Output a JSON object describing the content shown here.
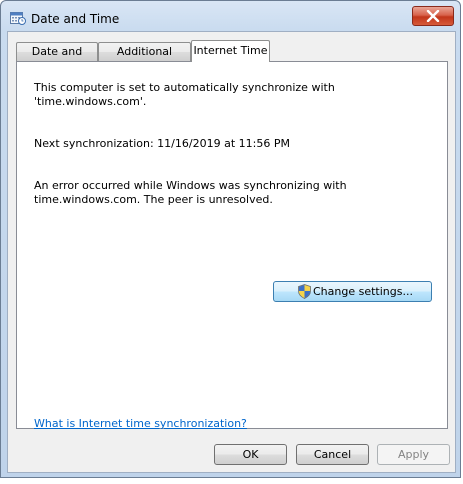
{
  "window": {
    "title": "Date and Time"
  },
  "tabs": [
    {
      "label": "Date and Time",
      "active": false
    },
    {
      "label": "Additional Clocks",
      "active": false
    },
    {
      "label": "Internet Time",
      "active": true
    }
  ],
  "internet_time": {
    "sync_line1": "This computer is set to automatically synchronize with",
    "sync_line2": "'time.windows.com'.",
    "next_sync": "Next synchronization: 11/16/2019 at 11:56 PM",
    "error_line1": "An error occurred while Windows was synchronizing with",
    "error_line2": "time.windows.com.  The peer is unresolved.",
    "change_settings_label": "Change settings...",
    "help_link": "What is Internet time synchronization?"
  },
  "footer": {
    "ok_label": "OK",
    "cancel_label": "Cancel",
    "apply_label": "Apply"
  },
  "icons": {
    "window_icon": "date-time-icon",
    "close": "close-icon",
    "shield": "shield-icon"
  }
}
